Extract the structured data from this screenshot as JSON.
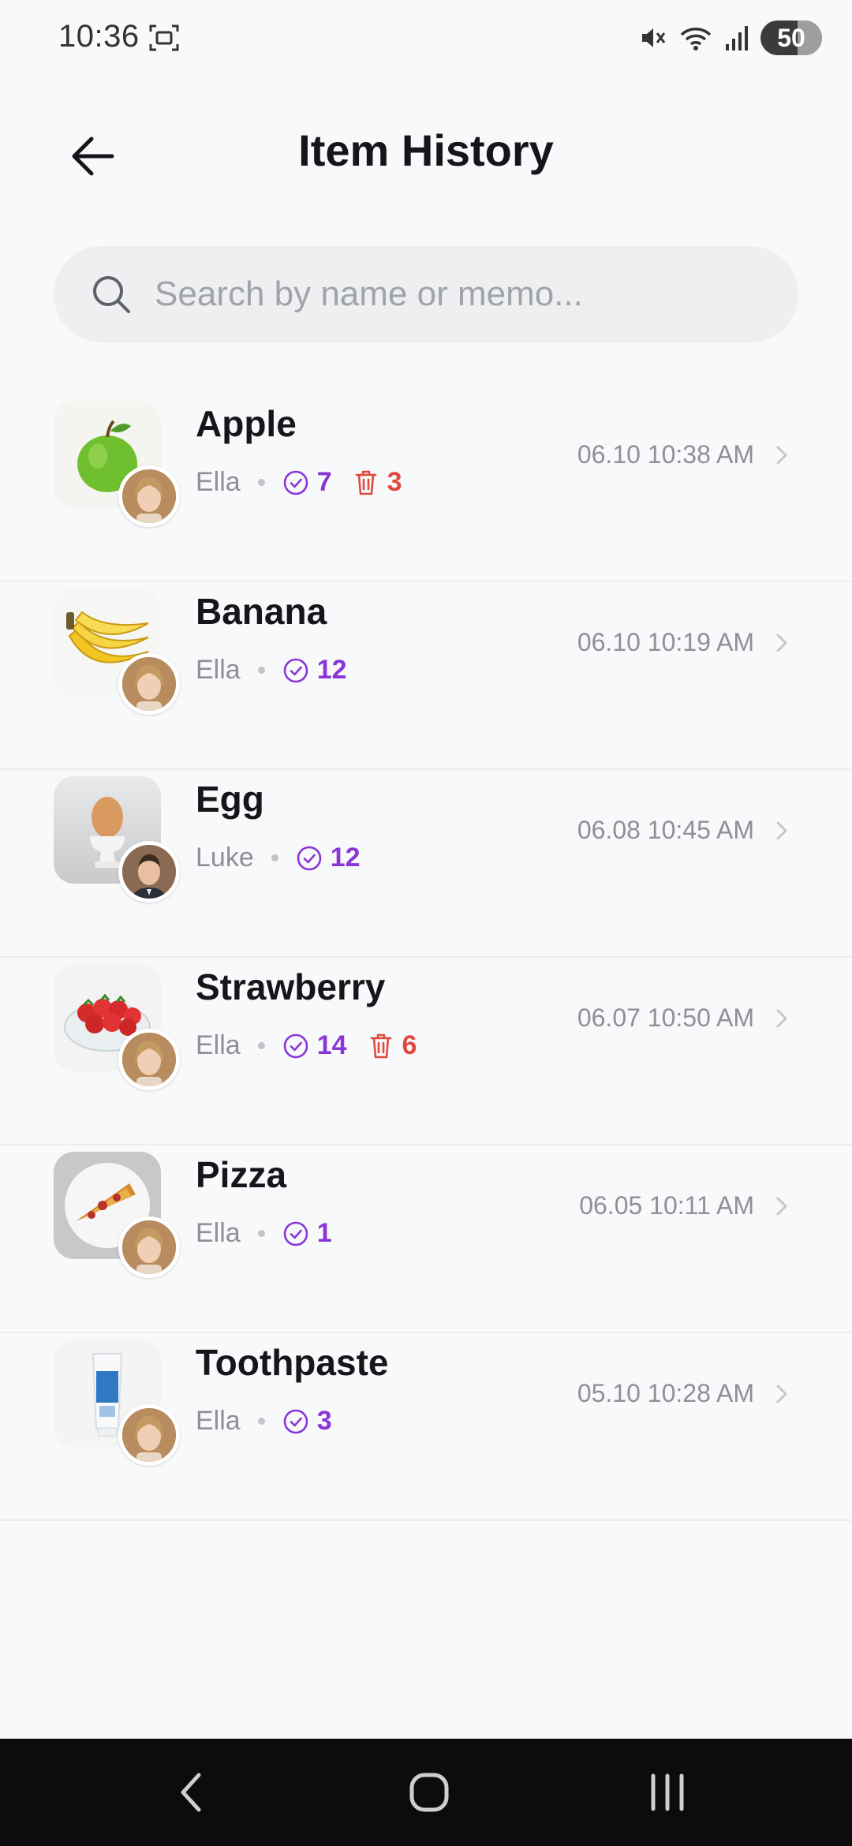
{
  "status_bar": {
    "time": "10:36",
    "battery": "50",
    "icons": [
      "screenshot-icon",
      "mute-icon",
      "wifi-icon",
      "signal-icon",
      "battery-icon"
    ]
  },
  "header": {
    "title": "Item History",
    "back_icon": "arrow-left-icon"
  },
  "search": {
    "placeholder": "Search by name or memo..."
  },
  "colors": {
    "accent_purple": "#8a36d6",
    "delete_red": "#e04a3e",
    "background": "#f8f9fb"
  },
  "items": [
    {
      "name": "Apple",
      "owner": "Ella",
      "checks": "7",
      "deletes": "3",
      "timestamp": "06.10 10:38 AM",
      "thumb": "apple",
      "avatar": "ella"
    },
    {
      "name": "Banana",
      "owner": "Ella",
      "checks": "12",
      "deletes": "",
      "timestamp": "06.10 10:19 AM",
      "thumb": "banana",
      "avatar": "ella"
    },
    {
      "name": "Egg",
      "owner": "Luke",
      "checks": "12",
      "deletes": "",
      "timestamp": "06.08 10:45 AM",
      "thumb": "egg",
      "avatar": "luke"
    },
    {
      "name": "Strawberry",
      "owner": "Ella",
      "checks": "14",
      "deletes": "6",
      "timestamp": "06.07 10:50 AM",
      "thumb": "strawberry",
      "avatar": "ella"
    },
    {
      "name": "Pizza",
      "owner": "Ella",
      "checks": "1",
      "deletes": "",
      "timestamp": "06.05 10:11 AM",
      "thumb": "pizza",
      "avatar": "ella"
    },
    {
      "name": "Toothpaste",
      "owner": "Ella",
      "checks": "3",
      "deletes": "",
      "timestamp": "05.10 10:28 AM",
      "thumb": "toothpaste",
      "avatar": "ella"
    }
  ],
  "nav_bar": {
    "buttons": [
      "back-nav-icon",
      "home-nav-icon",
      "recents-nav-icon"
    ]
  }
}
